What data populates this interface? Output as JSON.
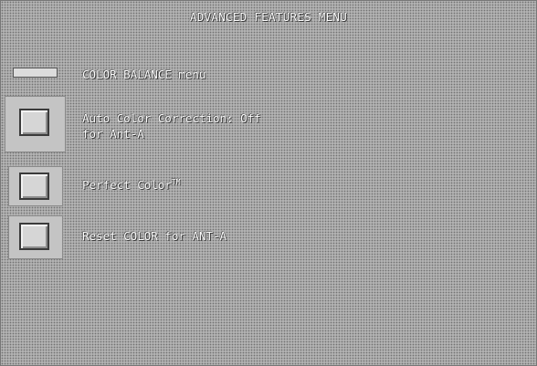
{
  "menu": {
    "title": "ADVANCED FEATURES MENU",
    "items": [
      {
        "label": "COLOR BALANCE menu"
      },
      {
        "label_line1": "Auto Color Correction: Off",
        "label_line2": "for Ant-A"
      },
      {
        "label": "Perfect Color",
        "trademark": "TM"
      },
      {
        "label": "Reset COLOR for ANT-A"
      }
    ]
  }
}
